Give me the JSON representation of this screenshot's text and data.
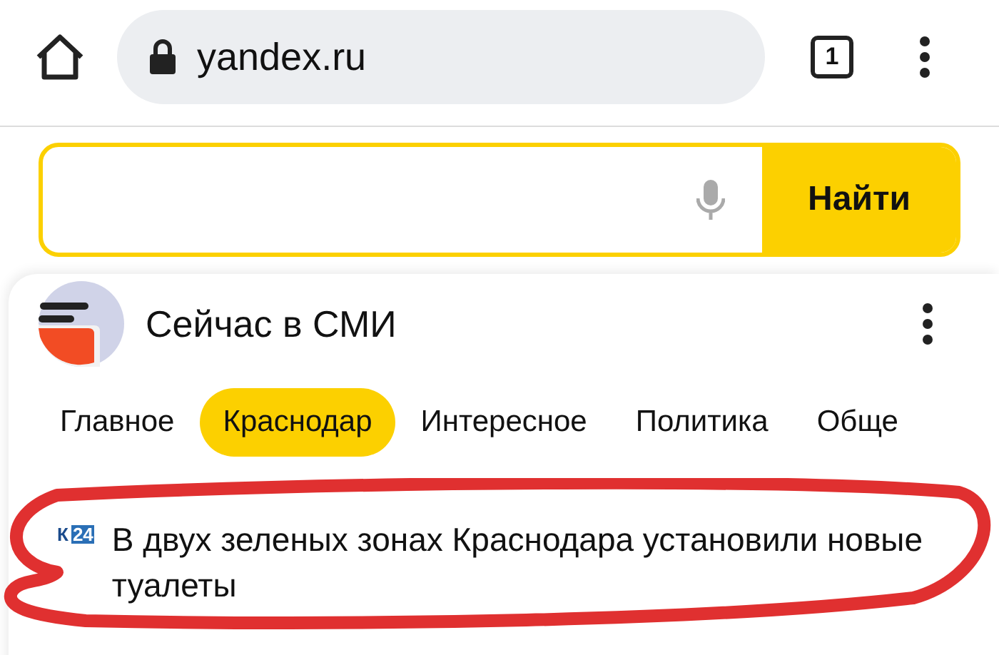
{
  "browser": {
    "url": "yandex.ru",
    "tab_count": "1"
  },
  "search": {
    "button": "Найти"
  },
  "news": {
    "title": "Сейчас в СМИ",
    "tabs": [
      {
        "label": "Главное",
        "selected": false
      },
      {
        "label": "Краснодар",
        "selected": true
      },
      {
        "label": "Интересное",
        "selected": false
      },
      {
        "label": "Политика",
        "selected": false
      },
      {
        "label": "Обще",
        "selected": false
      }
    ],
    "items": [
      {
        "source_letter": "К",
        "source_number": "24",
        "headline": "В двух зеленых зонах Краснодара установили новые туалеты"
      }
    ]
  }
}
